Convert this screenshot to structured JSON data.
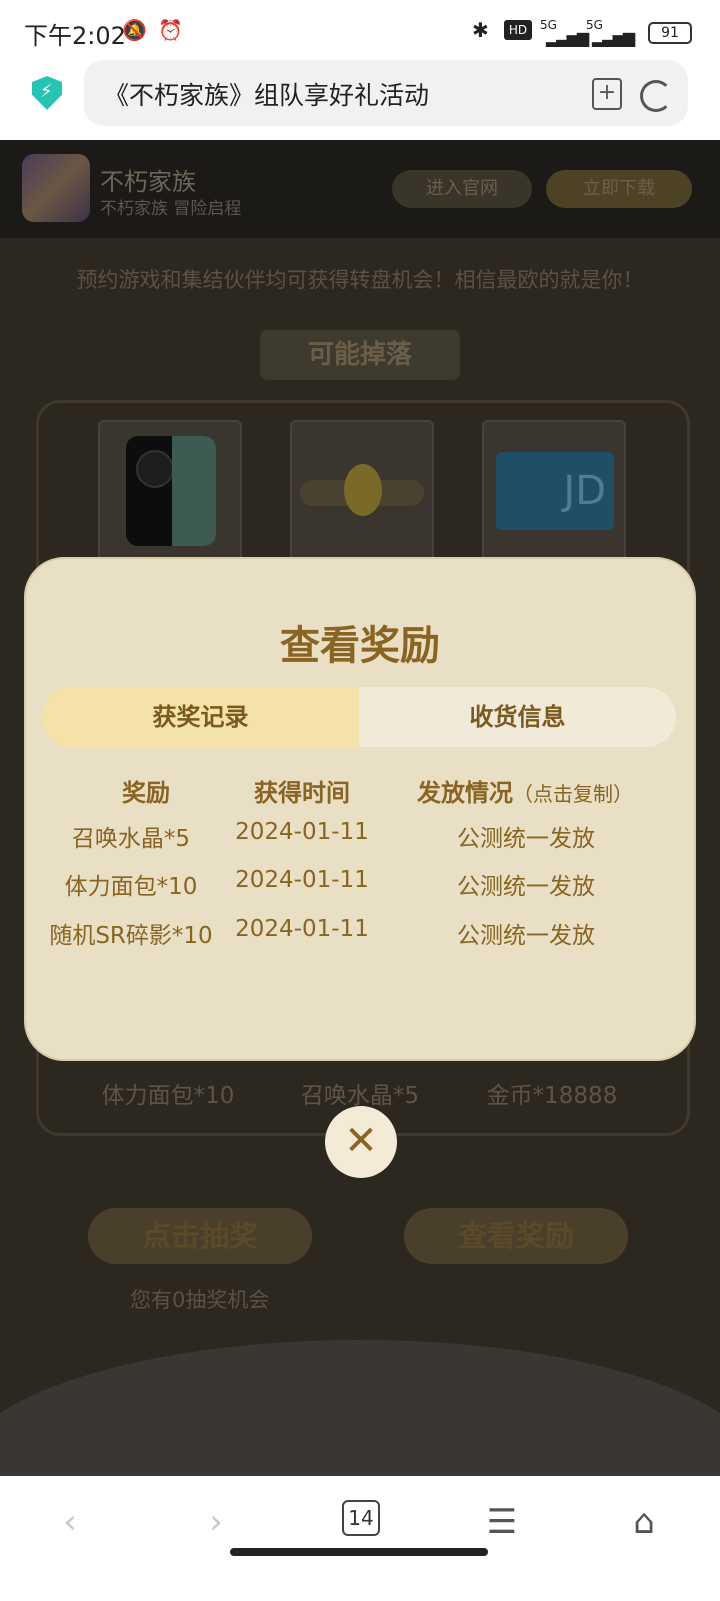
{
  "status_bar": {
    "time": "下午2:02",
    "battery": "91",
    "network_1": "5G",
    "network_2": "5G",
    "hd": "HD"
  },
  "address_bar": {
    "page_title": "《不朽家族》组队享好礼活动"
  },
  "app_header": {
    "name": "不朽家族",
    "subtitle": "不朽家族 冒险启程",
    "site_button": "进入官网",
    "download_button": "立即下载"
  },
  "page": {
    "promo_text": "预约游戏和集结伙伴均可获得转盘机会！相信最欧的就是你！",
    "drops_banner": "可能掉落",
    "bottom_prizes": [
      "体力面包*10",
      "召唤水晶*5",
      "金币*18888"
    ],
    "draw_button": "点击抽奖",
    "view_rewards_button": "查看奖励",
    "chances_text": "您有0抽奖机会"
  },
  "modal": {
    "title": "查看奖励",
    "tabs": [
      {
        "label": "获奖记录",
        "active": true
      },
      {
        "label": "收货信息",
        "active": false
      }
    ],
    "columns": {
      "reward": "奖励",
      "time": "获得时间",
      "status": "发放情况",
      "status_hint": "（点击复制）"
    },
    "rows": [
      {
        "reward": "召唤水晶*5",
        "time": "2024-01-11",
        "status": "公测统一发放"
      },
      {
        "reward": "体力面包*10",
        "time": "2024-01-11",
        "status": "公测统一发放"
      },
      {
        "reward": "随机SR碎影*10",
        "time": "2024-01-11",
        "status": "公测统一发放"
      }
    ],
    "close_icon": "close-icon"
  },
  "bottom_nav": {
    "tab_count": "14"
  },
  "colors": {
    "modal_bg": "#e8dfc4",
    "accent_gold": "#8a6422",
    "active_tab": "#f5e2a8"
  }
}
